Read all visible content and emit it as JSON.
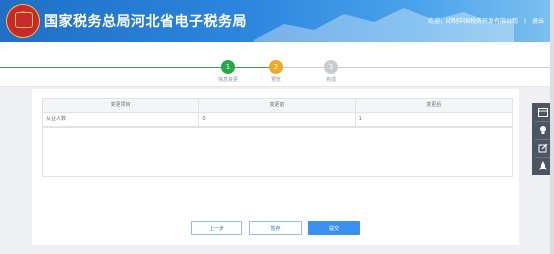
{
  "header": {
    "title": "国家税务总局河北省电子税务局",
    "welcome": "欢迎，印制中国税务开发有限公司",
    "separator": "|",
    "logout": "退出"
  },
  "steps": [
    {
      "num": "1",
      "label": "信息变更",
      "state": "done"
    },
    {
      "num": "2",
      "label": "预览",
      "state": "current"
    },
    {
      "num": "3",
      "label": "完成",
      "state": "pending"
    }
  ],
  "table": {
    "headers": [
      "变更项目",
      "变更前",
      "变更后"
    ],
    "rows": [
      [
        "从业人数",
        "0",
        "1"
      ]
    ]
  },
  "buttons": {
    "prev": "上一步",
    "save": "暂存",
    "submit": "提交"
  },
  "dock_icons": [
    "calendar-icon",
    "lightbulb-icon",
    "edit-icon",
    "rocket-icon"
  ],
  "colors": {
    "header_blue": "#1f6fc6",
    "step_done": "#29a84a",
    "step_current": "#f5a623",
    "step_pending": "#c7ccd1",
    "primary": "#3b8ff0"
  }
}
